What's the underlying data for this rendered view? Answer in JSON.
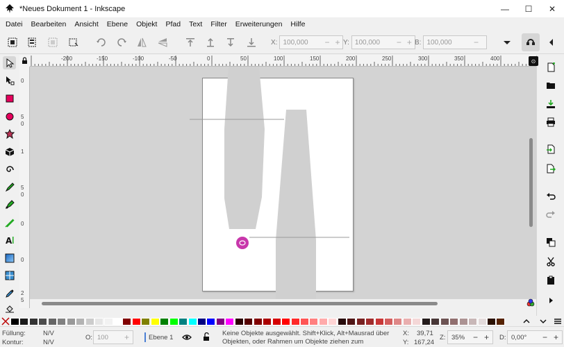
{
  "window": {
    "title": "*Neues Dokument 1 - Inkscape",
    "minimize": "—",
    "maximize": "☐",
    "close": "✕"
  },
  "menu": [
    "Datei",
    "Bearbeiten",
    "Ansicht",
    "Ebene",
    "Objekt",
    "Pfad",
    "Text",
    "Filter",
    "Erweiterungen",
    "Hilfe"
  ],
  "toolbar": {
    "x_label": "X:",
    "x_value": "100,000",
    "y_label": "Y:",
    "y_value": "100,000",
    "b_label": "B:",
    "b_value": "100,000",
    "minus": "−",
    "plus": "+"
  },
  "ruler": {
    "top_labels": [
      "-200",
      "-150",
      "-100",
      "-50",
      "0",
      "50",
      "100",
      "150",
      "200",
      "250",
      "300",
      "350",
      "400"
    ],
    "left_labels": [
      "0",
      "5",
      "0",
      "1",
      "5",
      "0",
      "0",
      "0",
      "2",
      "5"
    ]
  },
  "palette": {
    "colors": [
      "#000000",
      "#1a1a1a",
      "#333333",
      "#4d4d4d",
      "#666666",
      "#808080",
      "#999999",
      "#b3b3b3",
      "#cccccc",
      "#e6e6e6",
      "#f2f2f2",
      "#ffffff",
      "#800000",
      "#ff0000",
      "#808000",
      "#ffff00",
      "#008000",
      "#00ff00",
      "#008080",
      "#00ffff",
      "#000080",
      "#0000ff",
      "#800080",
      "#ff00ff",
      "#2b0000",
      "#550000",
      "#800000",
      "#aa0000",
      "#d40000",
      "#ff0000",
      "#ff2a2a",
      "#ff5555",
      "#ff8080",
      "#ffaaaa",
      "#ffd5d5",
      "#280b0b",
      "#501616",
      "#782121",
      "#a02c2c",
      "#c83737",
      "#d35f5f",
      "#de8787",
      "#e9afaf",
      "#f4d7d7",
      "#241c1c",
      "#483737",
      "#6c5353",
      "#916f6f",
      "#ac9393",
      "#c8b7b7",
      "#e3dbdb",
      "#2b1100",
      "#552200"
    ]
  },
  "status": {
    "fill_label": "Füllung:",
    "fill_value": "N/V",
    "stroke_label": "Kontur:",
    "stroke_value": "N/V",
    "opacity_label": "O:",
    "opacity_value": "100",
    "layer_name": "Ebene 1",
    "message": "Keine Objekte ausgewählt. Shift+Klick, Alt+Mausrad über Objekten, oder Rahmen um Objekte ziehen zum Auswählen.",
    "x_label": "X:",
    "x_value": "39,71",
    "y_label": "Y:",
    "y_value": "167,24",
    "zoom_label": "Z:",
    "zoom_value": "35%",
    "rotation_label": "D:",
    "rotation_value": "0,00°"
  },
  "colors": {
    "accent": "#c837ab",
    "canvas": "#d3d3d3",
    "shape_fill": "#d0d0d0"
  }
}
